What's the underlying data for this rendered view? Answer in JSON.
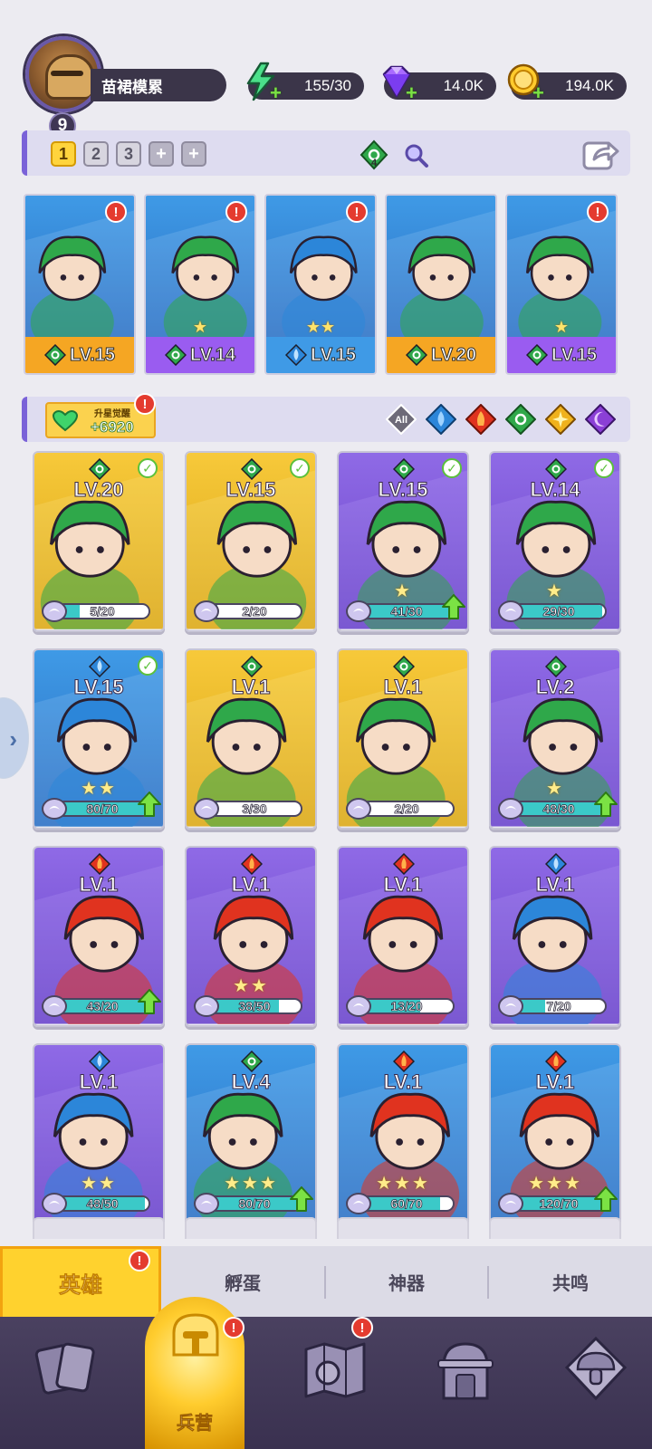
{
  "player": {
    "level": "9",
    "name": "苗裙模累"
  },
  "resources": {
    "energy": "155/30",
    "gems": "14.0K",
    "coins": "194.0K"
  },
  "team_bar": {
    "slots": [
      "1",
      "2",
      "3",
      "+",
      "+"
    ],
    "element_count": "4"
  },
  "team_members": [
    {
      "level": "LV.15",
      "stars": "",
      "element": "nature",
      "band_color": "#f5a623",
      "alert": "!"
    },
    {
      "level": "LV.14",
      "stars": "★",
      "element": "nature",
      "band_color": "#9a5cf0",
      "alert": "!"
    },
    {
      "level": "LV.15",
      "stars": "★★",
      "element": "water",
      "band_color": "#3f9ae6",
      "alert": "!"
    },
    {
      "level": "LV.20",
      "stars": "",
      "element": "nature",
      "band_color": "#f5a623",
      "alert": ""
    },
    {
      "level": "LV.15",
      "stars": "★",
      "element": "nature",
      "band_color": "#9a5cf0",
      "alert": "!"
    }
  ],
  "awaken": {
    "title": "升星觉醒",
    "value": "+6920",
    "alert": "!"
  },
  "filters": [
    "All",
    "water",
    "fire",
    "nature",
    "light",
    "dark"
  ],
  "heroes": [
    {
      "level": "LV.20",
      "element": "nature",
      "count": "5/20",
      "progress": 0.25,
      "stars": "",
      "checked": true,
      "upgrade": false,
      "bg": "gold"
    },
    {
      "level": "LV.15",
      "element": "nature",
      "count": "2/20",
      "progress": 0.1,
      "stars": "",
      "checked": true,
      "upgrade": false,
      "bg": "gold"
    },
    {
      "level": "LV.15",
      "element": "nature",
      "count": "41/30",
      "progress": 1,
      "stars": "★",
      "checked": true,
      "upgrade": true,
      "bg": "purple"
    },
    {
      "level": "LV.14",
      "element": "nature",
      "count": "29/30",
      "progress": 0.97,
      "stars": "★",
      "checked": true,
      "upgrade": false,
      "bg": "purple"
    },
    {
      "level": "LV.15",
      "element": "water",
      "count": "80/70",
      "progress": 1,
      "stars": "★★",
      "checked": true,
      "upgrade": true,
      "bg": "blue"
    },
    {
      "level": "LV.1",
      "element": "nature",
      "count": "3/30",
      "progress": 0.1,
      "stars": "",
      "checked": false,
      "upgrade": false,
      "bg": "gold"
    },
    {
      "level": "LV.1",
      "element": "nature",
      "count": "2/20",
      "progress": 0.1,
      "stars": "",
      "checked": false,
      "upgrade": false,
      "bg": "gold"
    },
    {
      "level": "LV.2",
      "element": "nature",
      "count": "48/30",
      "progress": 1,
      "stars": "★",
      "checked": false,
      "upgrade": true,
      "bg": "purple"
    },
    {
      "level": "LV.1",
      "element": "fire",
      "count": "43/20",
      "progress": 1,
      "stars": "",
      "checked": false,
      "upgrade": true,
      "bg": "purple"
    },
    {
      "level": "LV.1",
      "element": "fire",
      "count": "38/50",
      "progress": 0.76,
      "stars": "★★",
      "checked": false,
      "upgrade": false,
      "bg": "purple"
    },
    {
      "level": "LV.1",
      "element": "fire",
      "count": "13/20",
      "progress": 0.65,
      "stars": "",
      "checked": false,
      "upgrade": false,
      "bg": "purple"
    },
    {
      "level": "LV.1",
      "element": "water",
      "count": "7/20",
      "progress": 0.35,
      "stars": "",
      "checked": false,
      "upgrade": false,
      "bg": "purple"
    },
    {
      "level": "LV.1",
      "element": "water",
      "count": "48/50",
      "progress": 0.96,
      "stars": "★★",
      "checked": false,
      "upgrade": false,
      "bg": "purple"
    },
    {
      "level": "LV.4",
      "element": "nature",
      "count": "80/70",
      "progress": 1,
      "stars": "★★★",
      "checked": false,
      "upgrade": true,
      "bg": "blue"
    },
    {
      "level": "LV.1",
      "element": "fire",
      "count": "60/70",
      "progress": 0.86,
      "stars": "★★★",
      "checked": false,
      "upgrade": false,
      "bg": "blue"
    },
    {
      "level": "LV.1",
      "element": "fire",
      "count": "120/70",
      "progress": 1,
      "stars": "★★★",
      "checked": false,
      "upgrade": true,
      "bg": "blue"
    }
  ],
  "sub_tabs": {
    "heroes": "英雄",
    "hatch": "孵蛋",
    "artifact": "神器",
    "resonance": "共鸣",
    "heroes_alert": "!"
  },
  "bottom_nav": {
    "barracks_label": "兵营",
    "barracks_alert": "!",
    "map_alert": "!"
  },
  "colors": {
    "nature": "#2fa84a",
    "water": "#2c86d9",
    "fire": "#e0331f",
    "light": "#f0b21c",
    "dark": "#8b3fd6",
    "accent": "#7a62d8",
    "gold": "#ffd22e"
  }
}
